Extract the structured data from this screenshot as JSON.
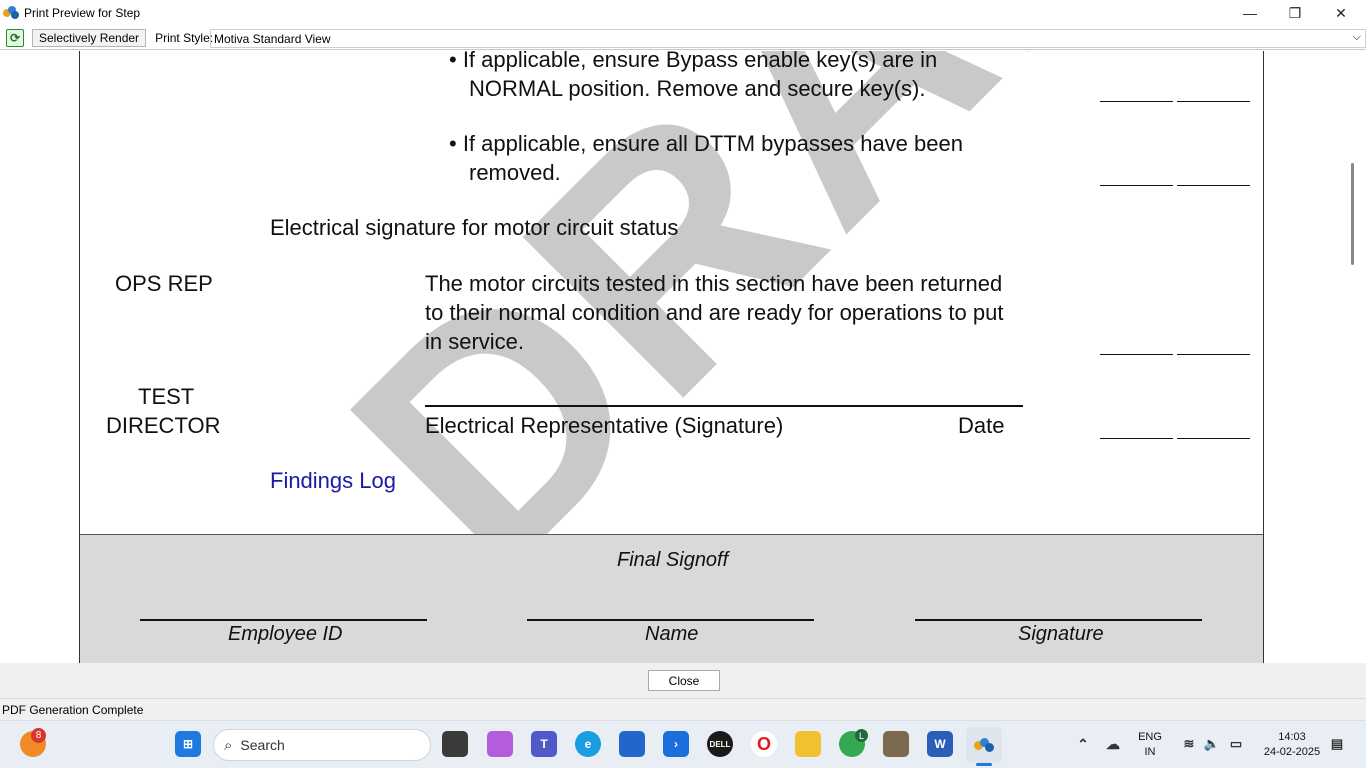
{
  "window": {
    "title": "Print Preview for Step",
    "minimize": "—",
    "restore": "❐",
    "close": "✕"
  },
  "toolbar": {
    "render_label": "Selectively Render",
    "print_style_label": "Print Style:",
    "print_style_value": "Motiva Standard View"
  },
  "document": {
    "bullet1_line1": "• If applicable, ensure Bypass enable key(s) are in",
    "bullet1_line2": "NORMAL position. Remove and secure key(s).",
    "bullet2_line1": "• If applicable, ensure all DTTM bypasses have been",
    "bullet2_line2": "removed.",
    "section_heading": "Electrical signature for motor circuit status",
    "role1": "OPS REP",
    "statement_line1": "The motor circuits tested in this section have been returned",
    "statement_line2": "to their normal condition and are ready for operations to put",
    "statement_line3": "in service.",
    "role2_line1": "TEST",
    "role2_line2": "DIRECTOR",
    "signature_label": "Electrical Representative (Signature)",
    "date_label": "Date",
    "findings_link": "Findings Log",
    "watermark": "DRAFT"
  },
  "footer": {
    "title": "Final Signoff",
    "employee_id": "Employee ID",
    "name": "Name",
    "signature": "Signature"
  },
  "dialog": {
    "close_label": "Close",
    "status": "PDF Generation Complete"
  },
  "taskbar": {
    "search_placeholder": "Search",
    "badge_count": "8",
    "chrome_badge": "L",
    "language_line1": "ENG",
    "language_line2": "IN",
    "time": "14:03",
    "date": "24-02-2025"
  },
  "colors": {
    "link": "#1a1aa8",
    "watermark": "#c9c9c9",
    "footer_band": "#d9d9d9"
  }
}
